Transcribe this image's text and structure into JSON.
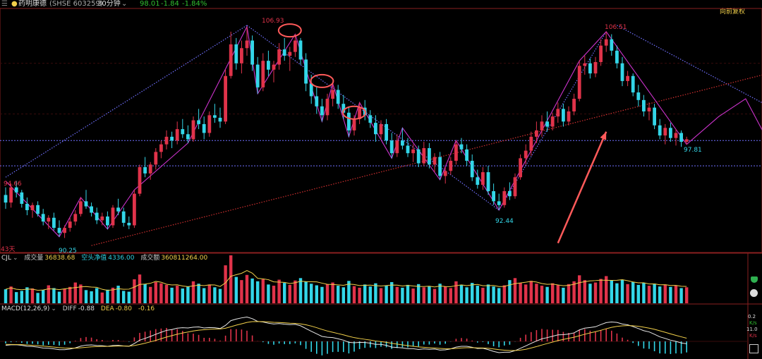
{
  "header": {
    "stock_name": "药明康德",
    "code": "(SHSE 603259)",
    "period": "30分钟",
    "price": "98.01",
    "change": "-1.84",
    "change_pct": "-1.84%",
    "adjust_mode": "向前复权"
  },
  "colors": {
    "up": "#e0334a",
    "down": "#33d6e8",
    "ma_yellow": "#f2d04a",
    "zigzag": "#cc33cc",
    "trend_blue": "#7070ff",
    "trend_red": "#d03030",
    "annotation": "#ff5a5a",
    "header_up": "#ffffff",
    "header_down": "#30c030"
  },
  "main_chart": {
    "period_label": "43天",
    "price_labels": {
      "low_left": "90.25",
      "left_mark": "94.66",
      "top_left": "106.93",
      "low_mid": "92.44",
      "top_right": "106.51",
      "last": "97.81"
    }
  },
  "volume_panel": {
    "indicator": "CJL",
    "items": [
      {
        "label": "成交量",
        "value": "36838.68"
      },
      {
        "label": "空头净值",
        "value": "4336.00"
      },
      {
        "label": "成交额",
        "value": "360811264.00"
      }
    ]
  },
  "macd_panel": {
    "indicator": "MACD(12,26,9)",
    "items": [
      {
        "label": "DIFF",
        "value": "-0.88"
      },
      {
        "label": "DEA",
        "value": "-0.80"
      },
      {
        "label": "",
        "value": "-0.16"
      }
    ]
  },
  "side_panel": {
    "v1": "0.2",
    "k1": "K/s",
    "v2": "11.0",
    "k2": "K/s"
  },
  "chart_data": {
    "type": "candlestick",
    "x_unit": "30-minute bar index",
    "price_range": [
      89.5,
      108.0
    ],
    "ohlc": [
      [
        0,
        93.6,
        94.2,
        92.5,
        93.0
      ],
      [
        1,
        93.0,
        94.5,
        92.6,
        94.2
      ],
      [
        2,
        94.2,
        94.7,
        93.4,
        93.8
      ],
      [
        3,
        93.8,
        94.0,
        92.6,
        92.9
      ],
      [
        4,
        92.9,
        93.4,
        92.0,
        92.4
      ],
      [
        5,
        92.4,
        93.0,
        91.8,
        92.8
      ],
      [
        6,
        92.8,
        93.1,
        91.9,
        92.1
      ],
      [
        7,
        92.1,
        92.5,
        91.2,
        91.5
      ],
      [
        8,
        91.5,
        92.0,
        90.9,
        91.8
      ],
      [
        9,
        91.8,
        92.2,
        90.8,
        91.0
      ],
      [
        10,
        91.0,
        91.6,
        90.3,
        90.6
      ],
      [
        11,
        90.6,
        91.2,
        90.2,
        91.0
      ],
      [
        12,
        91.0,
        91.8,
        90.7,
        91.5
      ],
      [
        13,
        91.5,
        92.4,
        91.2,
        92.1
      ],
      [
        14,
        92.1,
        93.4,
        91.9,
        93.1
      ],
      [
        15,
        93.1,
        94.0,
        92.5,
        92.7
      ],
      [
        16,
        92.7,
        93.0,
        91.9,
        92.2
      ],
      [
        17,
        92.2,
        92.6,
        91.3,
        91.6
      ],
      [
        18,
        91.6,
        92.2,
        91.2,
        91.9
      ],
      [
        19,
        91.9,
        92.3,
        90.9,
        91.2
      ],
      [
        20,
        91.2,
        92.8,
        91.0,
        92.6
      ],
      [
        21,
        92.6,
        93.3,
        92.0,
        92.3
      ],
      [
        22,
        92.3,
        92.6,
        91.1,
        91.4
      ],
      [
        23,
        91.4,
        91.9,
        90.9,
        91.2
      ],
      [
        24,
        91.2,
        94.0,
        91.0,
        93.7
      ],
      [
        25,
        93.7,
        96.0,
        93.5,
        95.8
      ],
      [
        26,
        95.8,
        96.6,
        95.0,
        95.3
      ],
      [
        27,
        95.3,
        96.2,
        94.8,
        96.0
      ],
      [
        28,
        96.0,
        97.3,
        95.6,
        97.0
      ],
      [
        29,
        97.0,
        97.9,
        96.5,
        97.6
      ],
      [
        30,
        97.6,
        98.7,
        97.2,
        98.2
      ],
      [
        31,
        98.2,
        98.6,
        97.3,
        97.9
      ],
      [
        32,
        97.9,
        99.4,
        97.6,
        98.8
      ],
      [
        33,
        98.8,
        99.6,
        98.1,
        98.4
      ],
      [
        34,
        98.4,
        99.1,
        97.7,
        98.0
      ],
      [
        35,
        98.0,
        99.8,
        97.8,
        99.5
      ],
      [
        36,
        99.5,
        100.4,
        98.8,
        99.2
      ],
      [
        37,
        99.2,
        99.8,
        98.0,
        98.5
      ],
      [
        38,
        98.5,
        100.2,
        98.2,
        99.9
      ],
      [
        39,
        99.9,
        100.8,
        99.3,
        99.7
      ],
      [
        40,
        99.7,
        100.5,
        98.9,
        99.4
      ],
      [
        41,
        99.4,
        103.5,
        99.2,
        103.0
      ],
      [
        42,
        103.0,
        106.5,
        102.8,
        105.5
      ],
      [
        43,
        105.5,
        106.0,
        103.5,
        104.0
      ],
      [
        44,
        104.0,
        105.8,
        103.2,
        105.2
      ],
      [
        45,
        105.2,
        106.9,
        104.6,
        105.8
      ],
      [
        46,
        105.8,
        106.2,
        103.4,
        103.9
      ],
      [
        47,
        103.9,
        104.5,
        101.6,
        102.1
      ],
      [
        48,
        102.1,
        104.8,
        101.8,
        104.2
      ],
      [
        49,
        104.2,
        105.0,
        103.0,
        103.5
      ],
      [
        50,
        103.5,
        104.2,
        102.5,
        103.9
      ],
      [
        51,
        103.9,
        105.6,
        103.5,
        105.1
      ],
      [
        52,
        105.1,
        106.0,
        104.2,
        104.6
      ],
      [
        53,
        104.6,
        105.3,
        103.4,
        104.9
      ],
      [
        54,
        104.9,
        106.3,
        104.5,
        105.8
      ],
      [
        55,
        105.8,
        106.0,
        103.9,
        104.3
      ],
      [
        56,
        104.3,
        104.8,
        101.8,
        102.4
      ],
      [
        57,
        102.4,
        103.1,
        100.8,
        101.4
      ],
      [
        58,
        101.4,
        102.2,
        100.0,
        100.6
      ],
      [
        59,
        100.6,
        101.2,
        99.4,
        99.9
      ],
      [
        60,
        99.9,
        101.6,
        99.5,
        101.2
      ],
      [
        61,
        101.2,
        102.4,
        100.6,
        101.9
      ],
      [
        62,
        101.9,
        102.3,
        100.4,
        100.8
      ],
      [
        63,
        100.8,
        101.5,
        99.6,
        100.1
      ],
      [
        64,
        100.1,
        100.6,
        98.2,
        98.7
      ],
      [
        65,
        98.7,
        99.9,
        98.3,
        99.6
      ],
      [
        66,
        99.6,
        100.9,
        99.2,
        100.5
      ],
      [
        67,
        100.5,
        101.1,
        99.5,
        99.9
      ],
      [
        68,
        99.9,
        100.3,
        98.9,
        99.3
      ],
      [
        69,
        99.3,
        99.9,
        97.8,
        98.4
      ],
      [
        70,
        98.4,
        99.5,
        98.0,
        99.2
      ],
      [
        71,
        99.2,
        99.6,
        97.6,
        97.9
      ],
      [
        72,
        97.9,
        98.5,
        96.5,
        96.9
      ],
      [
        73,
        96.9,
        98.4,
        96.6,
        97.9
      ],
      [
        74,
        97.9,
        98.9,
        97.2,
        97.5
      ],
      [
        75,
        97.5,
        98.1,
        96.6,
        96.9
      ],
      [
        76,
        96.9,
        97.6,
        96.2,
        97.2
      ],
      [
        77,
        97.2,
        97.5,
        95.8,
        96.1
      ],
      [
        78,
        96.1,
        97.8,
        95.9,
        97.3
      ],
      [
        79,
        97.3,
        97.7,
        95.7,
        96.0
      ],
      [
        80,
        96.0,
        96.9,
        95.4,
        96.6
      ],
      [
        81,
        96.6,
        97.0,
        94.8,
        95.1
      ],
      [
        82,
        95.1,
        95.8,
        94.5,
        95.5
      ],
      [
        83,
        95.5,
        96.6,
        95.2,
        96.3
      ],
      [
        84,
        96.3,
        97.9,
        96.0,
        97.6
      ],
      [
        85,
        97.6,
        98.1,
        96.9,
        97.2
      ],
      [
        86,
        97.2,
        97.6,
        95.9,
        96.3
      ],
      [
        87,
        96.3,
        96.8,
        94.7,
        95.0
      ],
      [
        88,
        95.0,
        95.6,
        94.1,
        94.4
      ],
      [
        89,
        94.4,
        95.8,
        94.0,
        95.4
      ],
      [
        90,
        95.4,
        95.9,
        93.6,
        93.9
      ],
      [
        91,
        93.9,
        94.5,
        92.8,
        93.1
      ],
      [
        92,
        93.1,
        93.7,
        92.4,
        92.8
      ],
      [
        93,
        92.8,
        94.2,
        92.6,
        93.9
      ],
      [
        94,
        93.9,
        94.6,
        93.2,
        93.5
      ],
      [
        95,
        93.5,
        95.3,
        93.3,
        95.0
      ],
      [
        96,
        95.0,
        96.8,
        94.8,
        96.5
      ],
      [
        97,
        96.5,
        97.6,
        96.0,
        97.1
      ],
      [
        98,
        97.1,
        98.6,
        96.7,
        98.2
      ],
      [
        99,
        98.2,
        99.4,
        97.7,
        98.7
      ],
      [
        100,
        98.7,
        99.9,
        98.2,
        99.4
      ],
      [
        101,
        99.4,
        100.2,
        98.6,
        99.0
      ],
      [
        102,
        99.0,
        100.1,
        98.7,
        99.8
      ],
      [
        103,
        99.8,
        100.9,
        99.3,
        100.4
      ],
      [
        104,
        100.4,
        100.8,
        99.0,
        99.4
      ],
      [
        105,
        99.4,
        100.6,
        99.1,
        100.2
      ],
      [
        106,
        100.2,
        101.6,
        99.9,
        101.2
      ],
      [
        107,
        101.2,
        104.2,
        101.0,
        103.8
      ],
      [
        108,
        103.8,
        104.6,
        103.1,
        104.0
      ],
      [
        109,
        104.0,
        104.4,
        102.8,
        103.2
      ],
      [
        110,
        103.2,
        104.5,
        102.9,
        104.1
      ],
      [
        111,
        104.1,
        105.9,
        103.8,
        105.4
      ],
      [
        112,
        105.4,
        106.5,
        104.9,
        105.9
      ],
      [
        113,
        105.9,
        106.3,
        104.6,
        105.0
      ],
      [
        114,
        105.0,
        105.4,
        103.6,
        104.0
      ],
      [
        115,
        104.0,
        104.5,
        102.2,
        102.6
      ],
      [
        116,
        102.6,
        103.4,
        102.2,
        103.0
      ],
      [
        117,
        103.0,
        103.2,
        101.4,
        101.7
      ],
      [
        118,
        101.7,
        102.3,
        100.6,
        101.1
      ],
      [
        119,
        101.1,
        101.5,
        99.8,
        100.2
      ],
      [
        120,
        100.2,
        100.9,
        99.5,
        100.5
      ],
      [
        121,
        100.5,
        100.8,
        98.8,
        99.1
      ],
      [
        122,
        99.1,
        99.6,
        98.0,
        98.3
      ],
      [
        123,
        98.3,
        99.2,
        97.6,
        98.9
      ],
      [
        124,
        98.9,
        99.3,
        97.8,
        98.1
      ],
      [
        125,
        98.1,
        98.8,
        97.5,
        98.5
      ],
      [
        126,
        98.5,
        98.7,
        97.4,
        97.8
      ],
      [
        127,
        97.8,
        98.2,
        97.6,
        98.0
      ]
    ],
    "volume": [
      35,
      42,
      28,
      31,
      40,
      37,
      26,
      33,
      45,
      38,
      29,
      36,
      41,
      52,
      47,
      33,
      30,
      38,
      27,
      34,
      39,
      44,
      31,
      29,
      60,
      72,
      48,
      41,
      53,
      50,
      46,
      39,
      44,
      37,
      42,
      55,
      49,
      38,
      47,
      40,
      36,
      95,
      120,
      66,
      58,
      71,
      62,
      55,
      60,
      47,
      44,
      59,
      51,
      46,
      57,
      63,
      54,
      49,
      45,
      41,
      48,
      52,
      44,
      40,
      56,
      43,
      39,
      47,
      42,
      50,
      38,
      45,
      53,
      41,
      39,
      46,
      37,
      48,
      40,
      43,
      36,
      49,
      42,
      38,
      55,
      46,
      40,
      51,
      44,
      39,
      47,
      42,
      38,
      45,
      58,
      63,
      51,
      47,
      56,
      49,
      44,
      41,
      50,
      46,
      39,
      48,
      55,
      70,
      58,
      49,
      52,
      61,
      68,
      57,
      50,
      59,
      48,
      53,
      46,
      51,
      44,
      49,
      42,
      47,
      41,
      45,
      38,
      40
    ],
    "macd": {
      "diff": [
        -0.4,
        -0.35,
        -0.34,
        -0.4,
        -0.5,
        -0.52,
        -0.58,
        -0.68,
        -0.7,
        -0.76,
        -0.84,
        -0.84,
        -0.78,
        -0.66,
        -0.48,
        -0.38,
        -0.36,
        -0.42,
        -0.44,
        -0.5,
        -0.42,
        -0.4,
        -0.46,
        -0.5,
        -0.22,
        0.12,
        0.3,
        0.5,
        0.72,
        0.92,
        1.12,
        1.2,
        1.34,
        1.38,
        1.36,
        1.44,
        1.46,
        1.36,
        1.4,
        1.38,
        1.3,
        1.62,
        2.1,
        2.26,
        2.38,
        2.46,
        2.3,
        2.02,
        1.96,
        1.84,
        1.76,
        1.8,
        1.74,
        1.7,
        1.72,
        1.58,
        1.3,
        1.02,
        0.76,
        0.5,
        0.42,
        0.38,
        0.26,
        0.12,
        -0.1,
        -0.14,
        -0.1,
        -0.12,
        -0.18,
        -0.3,
        -0.3,
        -0.4,
        -0.58,
        -0.62,
        -0.66,
        -0.74,
        -0.74,
        -0.82,
        -0.76,
        -0.8,
        -0.78,
        -0.88,
        -0.86,
        -0.76,
        -0.58,
        -0.5,
        -0.5,
        -0.6,
        -0.72,
        -0.7,
        -0.84,
        -1.02,
        -1.14,
        -1.1,
        -1.1,
        -0.94,
        -0.7,
        -0.46,
        -0.2,
        0.04,
        0.26,
        0.38,
        0.52,
        0.66,
        0.68,
        0.74,
        0.86,
        1.16,
        1.34,
        1.4,
        1.48,
        1.7,
        1.9,
        1.96,
        1.92,
        1.76,
        1.68,
        1.5,
        1.3,
        1.08,
        0.96,
        0.72,
        0.46,
        0.3,
        0.12,
        0.0,
        -0.16,
        -0.24
      ],
      "dea": [
        -0.3,
        -0.31,
        -0.32,
        -0.33,
        -0.37,
        -0.4,
        -0.43,
        -0.48,
        -0.53,
        -0.58,
        -0.63,
        -0.67,
        -0.69,
        -0.69,
        -0.65,
        -0.6,
        -0.55,
        -0.53,
        -0.51,
        -0.51,
        -0.49,
        -0.47,
        -0.47,
        -0.48,
        -0.42,
        -0.31,
        -0.19,
        -0.05,
        0.1,
        0.27,
        0.44,
        0.58,
        0.72,
        0.85,
        0.95,
        1.05,
        1.13,
        1.18,
        1.22,
        1.25,
        1.26,
        1.33,
        1.48,
        1.64,
        1.78,
        1.92,
        2.0,
        2.01,
        2.0,
        1.97,
        1.93,
        1.91,
        1.88,
        1.84,
        1.82,
        1.77,
        1.68,
        1.55,
        1.39,
        1.21,
        1.05,
        0.92,
        0.79,
        0.66,
        0.51,
        0.38,
        0.29,
        0.21,
        0.13,
        0.04,
        -0.03,
        -0.1,
        -0.2,
        -0.28,
        -0.36,
        -0.43,
        -0.5,
        -0.56,
        -0.6,
        -0.64,
        -0.67,
        -0.71,
        -0.74,
        -0.75,
        -0.71,
        -0.67,
        -0.64,
        -0.64,
        -0.66,
        -0.67,
        -0.7,
        -0.77,
        -0.84,
        -0.89,
        -0.93,
        -0.93,
        -0.88,
        -0.8,
        -0.67,
        -0.53,
        -0.37,
        -0.22,
        -0.07,
        0.08,
        0.2,
        0.31,
        0.42,
        0.57,
        0.72,
        0.86,
        0.98,
        1.12,
        1.28,
        1.42,
        1.52,
        1.57,
        1.6,
        1.58,
        1.53,
        1.44,
        1.34,
        1.22,
        1.07,
        0.92,
        0.76,
        0.61,
        0.46,
        0.32
      ]
    },
    "zigzag": [
      [
        0,
        94.7
      ],
      [
        10,
        90.3
      ],
      [
        14,
        93.4
      ],
      [
        19,
        90.9
      ],
      [
        24,
        94.0
      ],
      [
        34,
        97.7
      ],
      [
        45,
        106.9
      ],
      [
        47,
        101.6
      ],
      [
        54,
        106.3
      ],
      [
        59,
        99.4
      ],
      [
        61,
        102.4
      ],
      [
        64,
        98.2
      ],
      [
        66,
        100.9
      ],
      [
        72,
        96.5
      ],
      [
        74,
        98.9
      ],
      [
        81,
        94.8
      ],
      [
        84,
        97.9
      ],
      [
        92,
        92.4
      ],
      [
        107,
        104.2
      ],
      [
        112,
        106.5
      ],
      [
        127,
        97.6
      ],
      [
        133,
        99.8
      ],
      [
        138,
        101.2
      ],
      [
        142,
        98.0
      ]
    ],
    "trendlines": [
      {
        "color": "blue",
        "from": [
          0,
          95.0
        ],
        "to": [
          45,
          107.0
        ]
      },
      {
        "color": "blue",
        "from": [
          45,
          107.0
        ],
        "to": [
          92,
          92.4
        ]
      },
      {
        "color": "blue",
        "from": [
          92,
          92.4
        ],
        "to": [
          112,
          106.5
        ]
      },
      {
        "color": "blue",
        "from": [
          114,
          107.0
        ],
        "to": [
          145,
          100.0
        ]
      },
      {
        "color": "red",
        "from": [
          16,
          89.6
        ],
        "to": [
          145,
          103.5
        ]
      }
    ],
    "h_levels": [
      97.9,
      95.9
    ],
    "circles": [
      [
        53,
        106.6
      ],
      [
        59,
        102.6
      ],
      [
        65,
        100.1
      ]
    ],
    "arrow": {
      "from": [
        103,
        89.8
      ],
      "to": [
        112,
        98.6
      ]
    }
  }
}
